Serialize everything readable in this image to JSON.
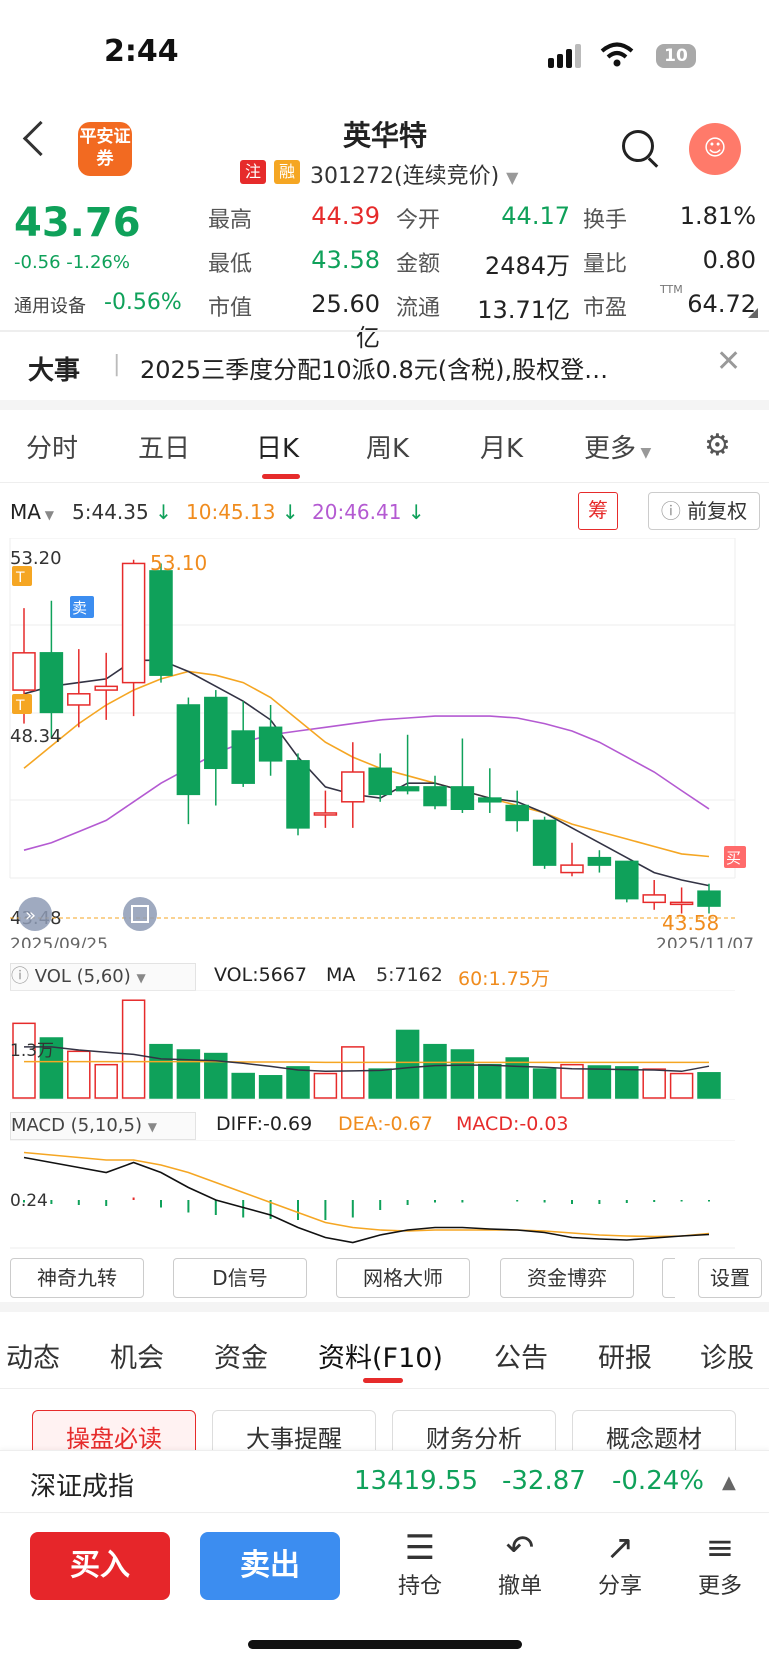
{
  "status": {
    "time": "2:44",
    "battery": "10"
  },
  "header": {
    "broker_logo": "平安证券",
    "stock_name": "英华特",
    "tag1": "注",
    "tag2": "融",
    "code_text": "301272(连续竞价)"
  },
  "quote": {
    "price": "43.76",
    "change": "-0.56  -1.26%",
    "sector_label": "通用设备",
    "sector_change": "-0.56%",
    "items": [
      {
        "label": "最高",
        "value": "44.39",
        "color": "#e62b2b"
      },
      {
        "label": "今开",
        "value": "44.17",
        "color": "#0fa15a"
      },
      {
        "label": "换手",
        "value": "1.81%",
        "color": "#222222"
      },
      {
        "label": "最低",
        "value": "43.58",
        "color": "#0fa15a"
      },
      {
        "label": "金额",
        "value": "2484万",
        "color": "#222222"
      },
      {
        "label": "量比",
        "value": "0.80",
        "color": "#222222"
      },
      {
        "label": "市值",
        "value": "25.60亿",
        "color": "#222222"
      },
      {
        "label": "流通",
        "value": "13.71亿",
        "color": "#222222"
      },
      {
        "label": "市盈",
        "value": "64.72",
        "color": "#222222"
      }
    ],
    "pe_sup": "TTM"
  },
  "event": {
    "title": "大事",
    "text": "2025三季度分配10派0.8元(含税),股权登…"
  },
  "chart_tabs": [
    "分时",
    "五日",
    "日K",
    "周K",
    "月K",
    "更多"
  ],
  "ma": {
    "label": "MA",
    "ma5": "5:44.35",
    "ma10": "10:45.13",
    "ma20": "20:46.41"
  },
  "chart_buttons": {
    "chou": "筹",
    "fuquan": "前复权"
  },
  "kline_labels": {
    "top": "53.20",
    "mid": "48.34",
    "bottom": "43.48",
    "max_label": "53.10",
    "min_label": "43.58",
    "date_start": "2025/09/25",
    "date_end": "2025/11/07",
    "t": "T",
    "sell": "卖",
    "buy": "买"
  },
  "vol": {
    "title": "VOL (5,60)",
    "vol": "VOL:5667",
    "ma": "MA",
    "ma5": "5:7162",
    "ma60": "60:1.75万",
    "axis": "1.3万"
  },
  "macd": {
    "title": "MACD (5,10,5)",
    "diff": "DIFF:-0.69",
    "dea": "DEA:-0.67",
    "macd": "MACD:-0.03",
    "axis": "0.24"
  },
  "tools": [
    "神奇九转",
    "D信号",
    "网格大师",
    "资金博弈",
    "设置"
  ],
  "info_tabs": [
    "动态",
    "机会",
    "资金",
    "资料(F10)",
    "公告",
    "研报",
    "诊股"
  ],
  "info_buttons": [
    "操盘必读",
    "大事提醒",
    "财务分析",
    "概念题材"
  ],
  "index": {
    "name": "深证成指",
    "value": "13419.55",
    "change": "-32.87",
    "pct": "-0.24%"
  },
  "actions": {
    "buy": "买入",
    "sell": "卖出",
    "hold": "持仓",
    "cancel": "撤单",
    "share": "分享",
    "more": "更多"
  },
  "chart_data": {
    "type": "candlestick",
    "x": [
      "2025/09/25",
      "",
      "",
      "",
      "",
      "",
      "",
      "",
      "",
      "",
      "",
      "",
      "",
      "",
      "",
      "",
      "",
      "",
      "",
      "",
      "",
      "",
      "",
      "",
      "",
      "2025/11/07"
    ],
    "candles": [
      {
        "o": 49.6,
        "c": 50.6,
        "h": 51.8,
        "l": 48.7
      },
      {
        "o": 50.6,
        "c": 49.0,
        "h": 52.0,
        "l": 48.3
      },
      {
        "o": 49.2,
        "c": 49.5,
        "h": 50.7,
        "l": 48.6
      },
      {
        "o": 49.6,
        "c": 49.7,
        "h": 50.6,
        "l": 48.8
      },
      {
        "o": 49.8,
        "c": 53.0,
        "h": 53.1,
        "l": 48.9
      },
      {
        "o": 52.8,
        "c": 50.0,
        "h": 53.0,
        "l": 49.8
      },
      {
        "o": 49.2,
        "c": 46.8,
        "h": 49.4,
        "l": 46.0
      },
      {
        "o": 49.4,
        "c": 47.5,
        "h": 49.6,
        "l": 46.5
      },
      {
        "o": 48.5,
        "c": 47.1,
        "h": 49.3,
        "l": 47.0
      },
      {
        "o": 48.6,
        "c": 47.7,
        "h": 49.2,
        "l": 47.3
      },
      {
        "o": 47.7,
        "c": 45.9,
        "h": 47.9,
        "l": 45.7
      },
      {
        "o": 46.3,
        "c": 46.3,
        "h": 46.9,
        "l": 45.9
      },
      {
        "o": 46.6,
        "c": 47.4,
        "h": 48.2,
        "l": 45.9
      },
      {
        "o": 47.5,
        "c": 46.8,
        "h": 47.9,
        "l": 46.6
      },
      {
        "o": 47.0,
        "c": 46.9,
        "h": 48.4,
        "l": 46.8
      },
      {
        "o": 47.0,
        "c": 46.5,
        "h": 47.3,
        "l": 46.4
      },
      {
        "o": 47.0,
        "c": 46.4,
        "h": 48.3,
        "l": 46.3
      },
      {
        "o": 46.7,
        "c": 46.6,
        "h": 47.5,
        "l": 46.3
      },
      {
        "o": 46.5,
        "c": 46.1,
        "h": 46.9,
        "l": 45.8
      },
      {
        "o": 46.1,
        "c": 44.9,
        "h": 46.2,
        "l": 44.8
      },
      {
        "o": 44.7,
        "c": 44.9,
        "h": 45.5,
        "l": 44.6
      },
      {
        "o": 45.1,
        "c": 44.9,
        "h": 45.3,
        "l": 44.7
      },
      {
        "o": 45.0,
        "c": 44.0,
        "h": 45.0,
        "l": 43.9
      },
      {
        "o": 43.9,
        "c": 44.1,
        "h": 44.5,
        "l": 43.7
      },
      {
        "o": 43.9,
        "c": 43.9,
        "h": 44.3,
        "l": 43.6
      },
      {
        "o": 44.2,
        "c": 43.8,
        "h": 44.4,
        "l": 43.6
      }
    ],
    "ma5": [
      49.5,
      49.7,
      49.8,
      49.9,
      50.4,
      50.4,
      50.1,
      49.7,
      49.3,
      48.8,
      47.8,
      47.0,
      46.8,
      46.7,
      47.1,
      47.1,
      46.9,
      46.7,
      46.6,
      46.3,
      45.9,
      45.5,
      45.1,
      44.7,
      44.5,
      44.35
    ],
    "ma10": [
      47.5,
      48.1,
      48.7,
      49.2,
      49.6,
      49.9,
      50.1,
      50.0,
      49.8,
      49.4,
      48.8,
      48.2,
      47.8,
      47.5,
      47.3,
      47.1,
      46.9,
      46.7,
      46.5,
      46.3,
      46.0,
      45.8,
      45.6,
      45.4,
      45.2,
      45.13
    ],
    "ma20": [
      45.3,
      45.5,
      45.8,
      46.1,
      46.6,
      47.1,
      47.5,
      47.9,
      48.2,
      48.4,
      48.5,
      48.6,
      48.7,
      48.8,
      48.85,
      48.9,
      48.9,
      48.9,
      48.85,
      48.7,
      48.5,
      48.2,
      47.8,
      47.4,
      46.9,
      46.41
    ],
    "ylim": [
      43.48,
      53.2
    ],
    "volume": [
      16800,
      13500,
      10500,
      7500,
      22000,
      12000,
      10800,
      10000,
      5500,
      5000,
      7000,
      5500,
      11500,
      6500,
      15200,
      12000,
      10800,
      7500,
      9000,
      6500,
      7500,
      7200,
      7000,
      6500,
      5500,
      5667
    ],
    "vol_ma5": [
      11500,
      11500,
      10800,
      10300,
      9800,
      8800,
      8600,
      8400,
      7800,
      7100,
      6300,
      6000,
      6100,
      6200,
      6800,
      7300,
      7400,
      7400,
      7100,
      6900,
      6600,
      6500,
      6400,
      6300,
      6000,
      7162
    ],
    "vol_ma60": [
      8200,
      8200,
      8200,
      8200,
      8200,
      8200,
      8200,
      8200,
      8100,
      8100,
      8100,
      8000,
      8000,
      8000,
      8000,
      8000,
      8000,
      8000,
      8000,
      8000,
      8000,
      8000,
      8000,
      8000,
      8000,
      8000
    ],
    "macd_diff": [
      0.85,
      0.75,
      0.65,
      0.55,
      0.75,
      0.55,
      0.25,
      0.0,
      -0.15,
      -0.3,
      -0.55,
      -0.75,
      -0.85,
      -0.7,
      -0.6,
      -0.55,
      -0.55,
      -0.58,
      -0.6,
      -0.65,
      -0.75,
      -0.78,
      -0.8,
      -0.76,
      -0.72,
      -0.69
    ],
    "macd_dea": [
      0.95,
      0.9,
      0.85,
      0.8,
      0.8,
      0.7,
      0.55,
      0.35,
      0.15,
      -0.05,
      -0.25,
      -0.45,
      -0.55,
      -0.6,
      -0.62,
      -0.6,
      -0.6,
      -0.6,
      -0.6,
      -0.62,
      -0.66,
      -0.7,
      -0.72,
      -0.73,
      -0.72,
      -0.67
    ],
    "macd_bar": [
      -0.05,
      -0.08,
      -0.1,
      -0.12,
      0.05,
      -0.15,
      -0.25,
      -0.3,
      -0.35,
      -0.38,
      -0.4,
      -0.4,
      -0.35,
      -0.2,
      -0.1,
      -0.05,
      -0.05,
      0.0,
      -0.03,
      -0.05,
      -0.08,
      -0.08,
      -0.06,
      -0.04,
      -0.03,
      -0.03
    ],
    "colors": {
      "up": "#e62b2b",
      "down": "#0fa15a",
      "ma5": "#333344",
      "ma10": "#f5a623",
      "ma20": "#b45ad2"
    }
  }
}
